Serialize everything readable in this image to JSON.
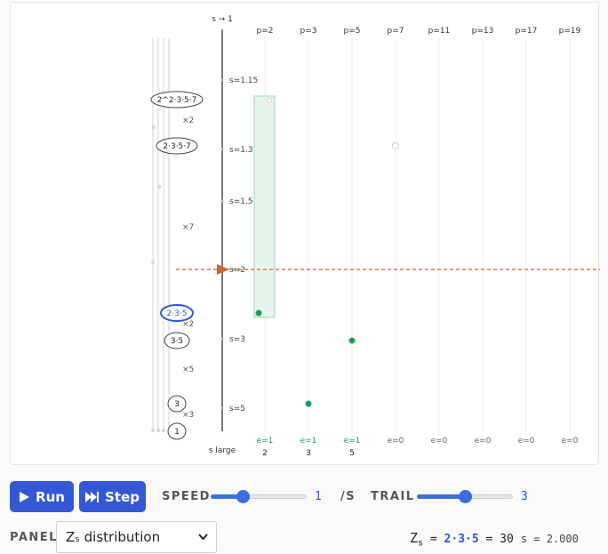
{
  "viz": {
    "top_label": "s → 1",
    "bottom_label": "s large",
    "s_ticks": [
      {
        "label": "s=1.15",
        "s": 1.15
      },
      {
        "label": "s=1.3",
        "s": 1.3
      },
      {
        "label": "s=1.5",
        "s": 1.5
      },
      {
        "label": "s=2",
        "s": 2
      },
      {
        "label": "s=3",
        "s": 3
      },
      {
        "label": "s=5",
        "s": 5
      }
    ],
    "primes": [
      "p=2",
      "p=3",
      "p=5",
      "p=7",
      "p=11",
      "p=13",
      "p=17",
      "p=19"
    ],
    "prime_values": [
      "2",
      "3",
      "5"
    ],
    "exponents": [
      "e=1",
      "e=1",
      "e=1",
      "e=0",
      "e=0",
      "e=0",
      "e=0",
      "e=0"
    ],
    "nodes": [
      {
        "label": "2^2·3·5·7",
        "highlight": false
      },
      {
        "label": "2·3·5·7",
        "highlight": false
      },
      {
        "label": "2·3·5",
        "highlight": true
      },
      {
        "label": "3·5",
        "highlight": false
      },
      {
        "label": "3",
        "highlight": false
      },
      {
        "label": "1",
        "highlight": false
      }
    ],
    "multipliers": [
      "×2",
      "×7",
      "×2",
      "×5",
      "×3"
    ],
    "current_s": 2
  },
  "controls": {
    "run_label": "Run",
    "step_label": "Step",
    "speed_label": "SPEED",
    "speed_value": "1",
    "speed_fraction": 0.33,
    "per_unit": "/S",
    "trail_label": "TRAIL",
    "trail_value": "3",
    "trail_fraction": 0.5
  },
  "footer": {
    "panel_label": "PANEL",
    "panel_select": "Zₛ distribution",
    "zs_prefix": "Z",
    "zs_sub": "s",
    "zs_eq": " = ",
    "zs_factors": "2·3·5",
    "zs_result": " = 30",
    "s_readout": "s = 2.000"
  },
  "colors": {
    "accent": "#3457d5",
    "green": "#1f9d55",
    "orange": "#c8683a"
  }
}
